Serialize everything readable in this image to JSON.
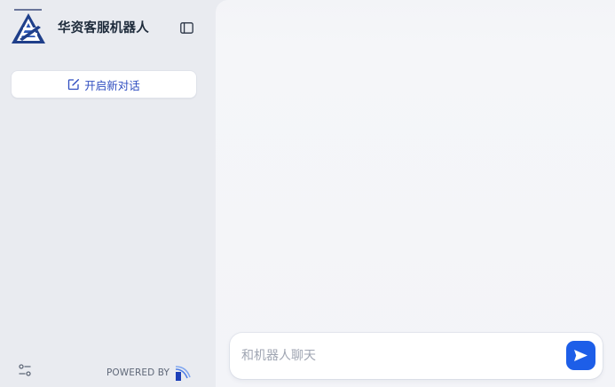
{
  "app": {
    "title": "华资客服机器人"
  },
  "sidebar": {
    "new_chat_label": "开启新对话",
    "powered_by": "POWERED BY"
  },
  "composer": {
    "placeholder": "和机器人聊天",
    "value": ""
  },
  "icons": {
    "logo": "logo-icon",
    "sidebar_toggle": "sidebar-toggle-icon",
    "new_chat": "edit-icon",
    "settings": "settings-sliders-icon",
    "brand": "brand-logo-icon",
    "send": "send-icon"
  },
  "colors": {
    "accent": "#1d5ee8",
    "new_chat_text": "#2f4dc0",
    "title_text": "#1e2b3b",
    "sidebar_bg": "#e9ebf0",
    "main_bg": "#f4f5f8"
  }
}
